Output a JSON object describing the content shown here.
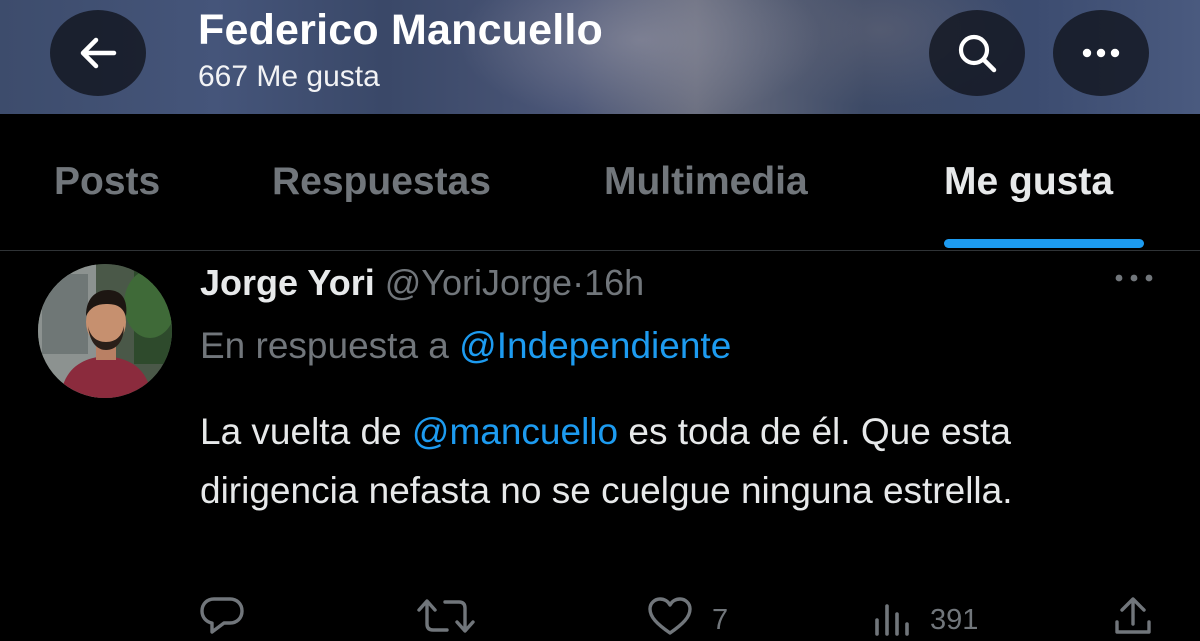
{
  "header": {
    "title": "Federico Mancuello",
    "subtitle": "667 Me gusta",
    "back_icon": "arrow-left-icon",
    "search_icon": "search-icon",
    "more_icon": "more-horizontal-icon"
  },
  "tabs": [
    {
      "label": "Posts",
      "active": false
    },
    {
      "label": "Respuestas",
      "active": false
    },
    {
      "label": "Multimedia",
      "active": false
    },
    {
      "label": "Me gusta",
      "active": true
    }
  ],
  "tweet": {
    "author_name": "Jorge Yori",
    "author_handle": "@YoriJorge",
    "separator": "·",
    "time": "16h",
    "reply_prefix": "En respuesta a ",
    "reply_to": "@Independiente",
    "text_before": "La vuelta de ",
    "mention": "@mancuello",
    "text_after": " es toda de él. Que esta dirigencia nefasta no se cuelgue ninguna estrella.",
    "actions": {
      "reply_icon": "reply-icon",
      "retweet_icon": "retweet-icon",
      "like_icon": "heart-icon",
      "like_count": "7",
      "views_icon": "views-icon",
      "views_count": "391",
      "share_icon": "share-icon"
    }
  },
  "colors": {
    "accent": "#1d9bf0",
    "muted": "#71767b",
    "text": "#e7e9ea",
    "background": "#000000"
  }
}
